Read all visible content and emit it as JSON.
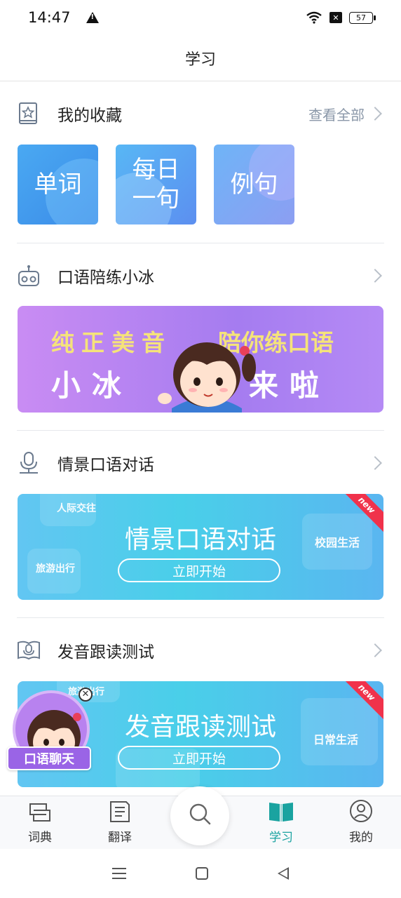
{
  "status_bar": {
    "time": "14:47",
    "battery": "57"
  },
  "header": {
    "title": "学习"
  },
  "favorites": {
    "title": "我的收藏",
    "more_label": "查看全部",
    "items": [
      {
        "label": "单词"
      },
      {
        "label": "每日\n一句"
      },
      {
        "label": "例句"
      }
    ]
  },
  "xiaobing": {
    "title": "口语陪练小冰",
    "banner_line1_left": "纯正美音",
    "banner_line1_right": "陪你练口语",
    "banner_line2_left": "小冰",
    "banner_line2_right": "来啦"
  },
  "scene_dialog": {
    "title": "情景口语对话",
    "banner_title": "情景口语对话",
    "start_label": "立即开始",
    "badge": "new",
    "tags": [
      "人际交往",
      "校园生活",
      "旅游出行"
    ]
  },
  "pronunciation": {
    "title": "发音跟读测试",
    "banner_title": "发音跟读测试",
    "start_label": "立即开始",
    "badge": "new",
    "tags": [
      "旅游出行",
      "日常生活"
    ]
  },
  "chat_float": {
    "label": "口语聊天"
  },
  "tabs": [
    {
      "label": "词典",
      "icon": "dictionary-icon"
    },
    {
      "label": "翻译",
      "icon": "translate-icon"
    },
    {
      "label": "",
      "icon": "search-icon"
    },
    {
      "label": "学习",
      "icon": "book-icon",
      "active": true
    },
    {
      "label": "我的",
      "icon": "profile-icon"
    }
  ],
  "colors": {
    "accent": "#1aa3a0",
    "xiaobing_purple": "#a57cf0",
    "scene_cyan": "#49cfe9",
    "new_red": "#f0324b"
  }
}
